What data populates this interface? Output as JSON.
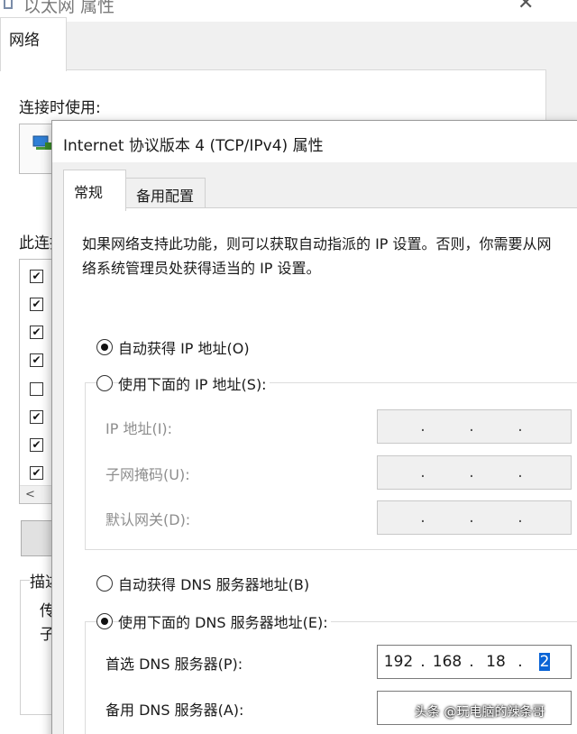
{
  "background_dialog": {
    "title": "以太网 属性",
    "close_symbol": "✕",
    "tab": "网络",
    "connect_using_label": "连接时使用:",
    "items_label": "此连接使用下列项目",
    "checkboxes": [
      "✔",
      "✔",
      "✔",
      "✔",
      "",
      "✔",
      "✔",
      "✔"
    ],
    "scroll_left": "<",
    "description_group_label": "描述",
    "description_lines": [
      "传",
      "子"
    ]
  },
  "dialog": {
    "title": "Internet 协议版本 4 (TCP/IPv4) 属性",
    "tabs": {
      "general": "常规",
      "alternate": "备用配置"
    },
    "description": [
      "如果网络支持此功能，则可以获取自动指派的 IP 设置。否则，你需要从网",
      "络系统管理员处获得适当的 IP 设置。"
    ],
    "ip_mode": {
      "auto_label": "自动获得 IP 地址(O)",
      "manual_label": "使用下面的 IP 地址(S):",
      "selected": "auto"
    },
    "ip_fields": [
      {
        "label": "IP 地址(I):",
        "segments": [
          "",
          "",
          "",
          ""
        ],
        "dots": [
          ".",
          ".",
          "."
        ]
      },
      {
        "label": "子网掩码(U):",
        "segments": [
          "",
          "",
          "",
          ""
        ],
        "dots": [
          ".",
          ".",
          "."
        ]
      },
      {
        "label": "默认网关(D):",
        "segments": [
          "",
          "",
          "",
          ""
        ],
        "dots": [
          ".",
          ".",
          "."
        ]
      }
    ],
    "dns_mode": {
      "auto_label": "自动获得 DNS 服务器地址(B)",
      "manual_label": "使用下面的 DNS 服务器地址(E):",
      "selected": "manual"
    },
    "dns_fields": [
      {
        "label": "首选 DNS 服务器(P):",
        "segments": [
          "192",
          "168",
          "18",
          "2"
        ],
        "dots": [
          ".",
          ".",
          "."
        ]
      },
      {
        "label": "备用 DNS 服务器(A):",
        "segments": [
          "",
          "",
          "",
          ""
        ],
        "dots": [
          "",
          "",
          ""
        ]
      }
    ]
  },
  "watermark": "头条 @玩电脑的辣条哥",
  "colors": {
    "selection": "#0a64d6",
    "disabled_text": "#8e8e8e"
  }
}
